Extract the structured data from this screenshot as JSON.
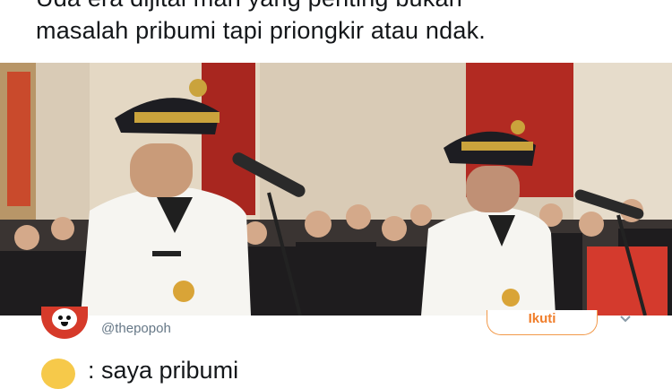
{
  "tweet": {
    "text_line1": "Uda era dijital mah yang penting bukan",
    "text_line2": "masalah pribumi tapi priongkir atau ndak."
  },
  "photo": {
    "description_icon": "photo-inauguration"
  },
  "author": {
    "handle": "@thepopoh",
    "follow_label": "Ikuti",
    "avatar_icon": "avatar-icon",
    "menu_icon": "chevron-down-icon"
  },
  "reply": {
    "emoji_icon": "emoji-face-icon",
    "text": ": saya pribumi"
  },
  "colors": {
    "follow_accent": "#f07d2a",
    "avatar_bg": "#d63a2a",
    "handle": "#657786"
  }
}
